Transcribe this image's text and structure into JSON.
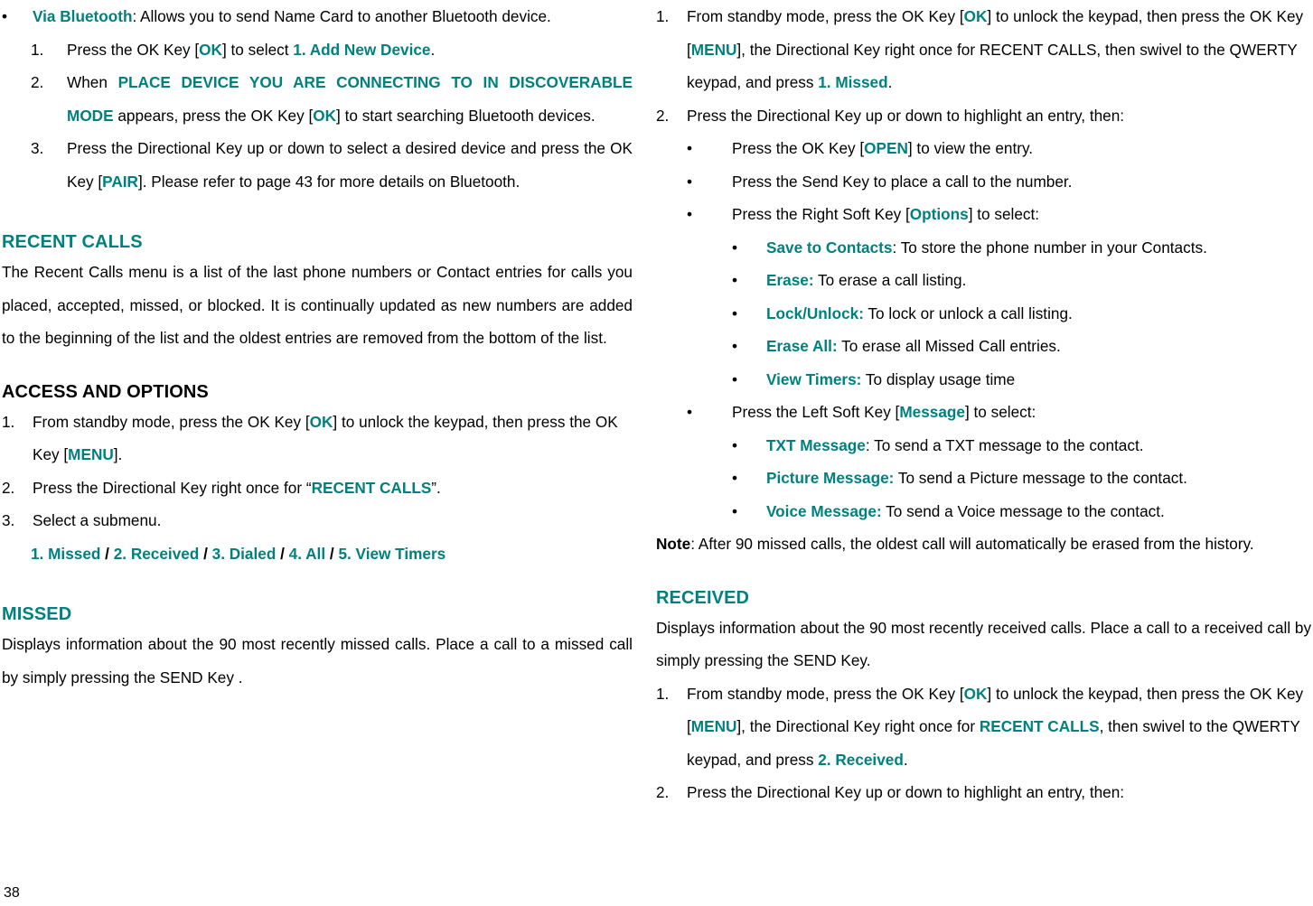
{
  "page": {
    "number": "38",
    "accent_color": "#00807f",
    "text_color": "#000000",
    "background": "#ffffff"
  },
  "left_column": {
    "bluetooth_bullet": {
      "marker": "•",
      "term": "Via Bluetooth",
      "rest": ": Allows you to send Name Card to another Bluetooth device."
    },
    "bluetooth_steps": [
      {
        "marker": "1.",
        "pre": "Press the OK Key [",
        "key": "OK",
        "mid": "] to select ",
        "target": "1. Add New Device",
        "post": "."
      },
      {
        "marker": "2.",
        "pre": "When ",
        "prompt": "PLACE DEVICE YOU ARE CONNECTING TO IN DISCOVERABLE MODE",
        "mid": " appears, press the OK Key [",
        "key": "OK",
        "post": "] to start searching Bluetooth devices."
      },
      {
        "marker": "3.",
        "pre": "Press the Directional Key up or down to select a desired device and press the OK Key [",
        "key": "PAIR",
        "post": "]. Please refer to page 43 for more details on Bluetooth."
      }
    ],
    "recent_calls_heading": "RECENT CALLS",
    "recent_calls_body": "The Recent Calls menu is a list of the last phone numbers or Contact entries for calls you placed, accepted, missed, or blocked. It is continually updated as new numbers are added to the beginning of the list and the oldest entries are removed from the bottom of the list.",
    "access_heading": "ACCESS AND OPTIONS",
    "access_steps": [
      {
        "marker": "1.",
        "pre": "From standby mode, press the OK Key [",
        "key1": "OK",
        "mid": "] to unlock the keypad, then press the OK Key [",
        "key2": "MENU",
        "post": "]."
      },
      {
        "marker": "2.",
        "pre": "Press the Directional Key right once for “",
        "target": "RECENT CALLS",
        "post": "”."
      },
      {
        "marker": "3.",
        "pre": "Select a submenu.",
        "target": "",
        "post": ""
      }
    ],
    "submenu_line": {
      "items": [
        "1. Missed",
        "2. Received",
        "3. Dialed",
        "4. All",
        "5. View Timers"
      ],
      "separator": " / "
    },
    "missed_heading": "MISSED",
    "missed_body": "Displays information about the 90 most recently missed calls. Place a call to a missed call by simply pressing the SEND Key ."
  },
  "right_column": {
    "missed_steps": [
      {
        "marker": "1.",
        "pre": "From standby mode, press the OK Key [",
        "key1": "OK",
        "mid1": "] to unlock the keypad, then press the OK Key [",
        "key2": "MENU",
        "mid2": "], the Directional Key right once for RECENT CALLS,  then swivel to the QWERTY keypad, and press ",
        "target": "1. Missed",
        "post": "."
      },
      {
        "marker": "2.",
        "text": "Press the Directional Key up or down to highlight an entry, then:"
      }
    ],
    "missed_bullets": [
      {
        "marker": "•",
        "pre": "Press the OK Key [",
        "key": "OPEN",
        "post": "] to view the entry."
      },
      {
        "marker": "•",
        "pre": "Press the Send Key to place a call to the number.",
        "key": "",
        "post": ""
      },
      {
        "marker": "•",
        "pre": "Press the Right Soft Key [",
        "key": "Options",
        "post": "] to select:"
      }
    ],
    "options_items": [
      {
        "marker": "•",
        "term": "Save to Contacts",
        "colon_teal": false,
        "rest": ": To store the phone number in your Contacts."
      },
      {
        "marker": "•",
        "term": "Erase:",
        "colon_teal": true,
        "rest": " To erase a call listing."
      },
      {
        "marker": "•",
        "term": "Lock/Unlock:",
        "colon_teal": true,
        "rest": " To lock or unlock a call listing."
      },
      {
        "marker": "•",
        "term": "Erase All:",
        "colon_teal": true,
        "rest": " To erase all Missed Call entries."
      },
      {
        "marker": "•",
        "term": "View Timers:",
        "colon_teal": true,
        "rest": " To display usage time"
      }
    ],
    "message_bullet": {
      "marker": "•",
      "pre": "Press the Left Soft Key [",
      "key": "Message",
      "post": "] to select:"
    },
    "message_items": [
      {
        "marker": "•",
        "term": "TXT Message",
        "rest": ": To send a TXT message to the contact."
      },
      {
        "marker": "•",
        "term": "Picture Message:",
        "rest": " To send a Picture message to the contact."
      },
      {
        "marker": "•",
        "term": "Voice Message:",
        "rest": " To send a Voice message to the contact."
      }
    ],
    "note": {
      "label": "Note",
      "text": ": After 90 missed calls, the oldest call will automatically be erased from the history."
    },
    "received_heading": "RECEIVED",
    "received_body": "Displays information about the 90 most recently received calls. Place a call to a received call by simply pressing the SEND Key.",
    "received_steps": [
      {
        "marker": "1.",
        "pre": "From standby mode, press the OK Key [",
        "key1": "OK",
        "mid1": "] to unlock the keypad, then press the OK Key [",
        "key2": "MENU",
        "mid2": "], the Directional Key right once for ",
        "target1": "RECENT CALLS",
        "mid3": ", then swivel to the QWERTY keypad, and press ",
        "target2": "2. Received",
        "post": "."
      },
      {
        "marker": "2.",
        "text": "Press the Directional Key up or down to highlight an entry, then:"
      }
    ]
  }
}
